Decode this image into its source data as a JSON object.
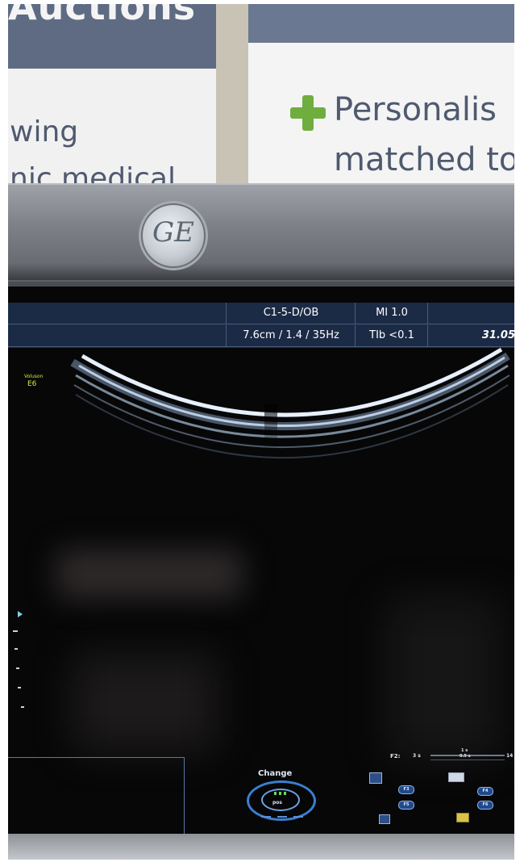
{
  "background": {
    "poster_left": {
      "heading": "Auctions",
      "line1": "wing",
      "line2": "nic medical"
    },
    "poster_right": {
      "line1": "Personalis",
      "line2": "matched to"
    }
  },
  "bezel": {
    "logo_text": "GE"
  },
  "ultrasound_header": {
    "row1": {
      "probe": "C1-5-D/OB",
      "mi": "MI  1.0"
    },
    "row2": {
      "params": "7.6cm / 1.4 / 35Hz",
      "tib": "TIb <0.1",
      "value": "31.05"
    }
  },
  "brand": {
    "name": "Voluson",
    "model": "E6"
  },
  "controls": {
    "change_label": "Change",
    "dial_label": "pos",
    "f2_label": "F2:",
    "f2_value": "3 s",
    "scale_top": "1 s",
    "scale_sub": "0.5 s",
    "right_value": "14",
    "pills": [
      "F3",
      "F5",
      "F4",
      "F6"
    ]
  },
  "colors": {
    "header_bg": "#1c2b45",
    "brand_text": "#d7e83a",
    "accent_blue": "#3b7fd0"
  }
}
